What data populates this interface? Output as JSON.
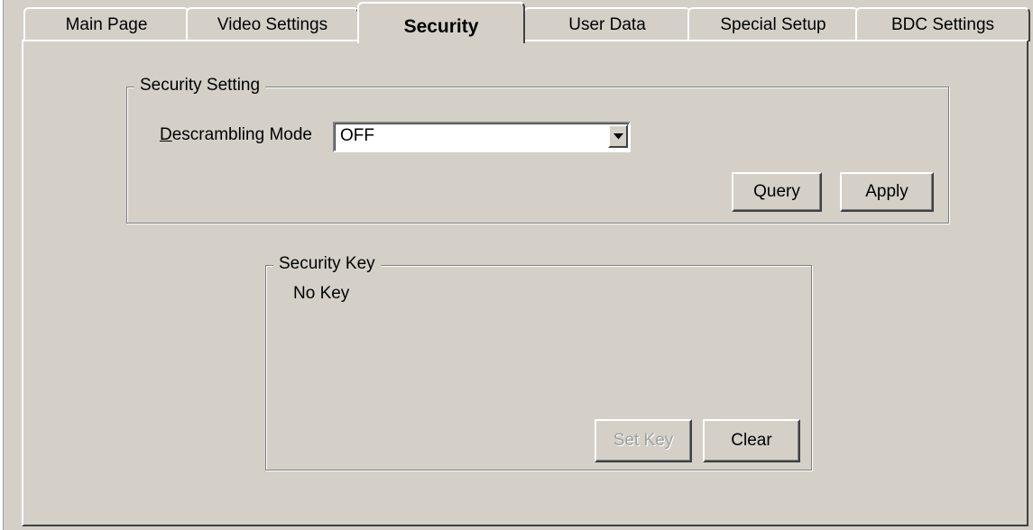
{
  "tabs": [
    {
      "label": "Main Page"
    },
    {
      "label": "Video Settings"
    },
    {
      "label": "Security",
      "active": true
    },
    {
      "label": "User Data"
    },
    {
      "label": "Special Setup"
    },
    {
      "label": "BDC Settings"
    }
  ],
  "security_setting": {
    "group_title": "Security Setting",
    "mode_label_mnemonic": "D",
    "mode_label_rest": "escrambling Mode",
    "mode_value": "OFF",
    "query_label": "Query",
    "apply_label": "Apply"
  },
  "security_key": {
    "group_title": "Security Key",
    "status_text": "No Key",
    "set_key_label": "Set Key",
    "clear_label": "Clear"
  },
  "icons": {
    "dropdown": "chevron-down-icon"
  }
}
